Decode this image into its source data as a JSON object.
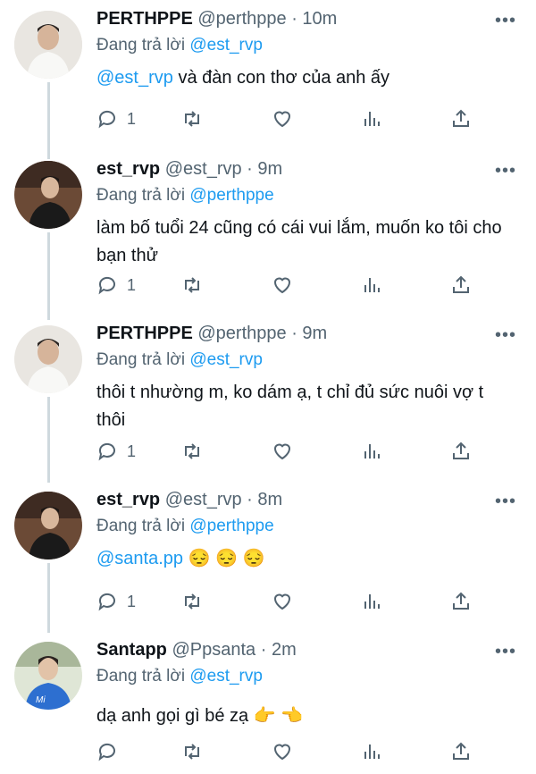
{
  "tweets": [
    {
      "name": "PERTHPPE",
      "handle": "@perthppe",
      "sep": " · ",
      "time": "10m",
      "reply_prefix": "Đang trả lời ",
      "reply_to": "@est_rvp",
      "body_mention": "@est_rvp",
      "body_text": " và đàn con thơ của anh ấy",
      "more": "•••",
      "reply_count": "1"
    },
    {
      "name": "est_rvp",
      "handle": "@est_rvp",
      "sep": " · ",
      "time": "9m",
      "reply_prefix": "Đang trả lời ",
      "reply_to": "@perthppe",
      "body_mention": "",
      "body_text": "làm bố tuổi 24 cũng có cái vui lắm, muốn ko tôi cho bạn thử",
      "more": "•••",
      "reply_count": "1"
    },
    {
      "name": "PERTHPPE",
      "handle": "@perthppe",
      "sep": " · ",
      "time": "9m",
      "reply_prefix": "Đang trả lời ",
      "reply_to": "@est_rvp",
      "body_mention": "",
      "body_text": "thôi t nhường m, ko dám ạ, t chỉ đủ sức nuôi vợ t thôi",
      "more": "•••",
      "reply_count": "1"
    },
    {
      "name": "est_rvp",
      "handle": "@est_rvp",
      "sep": " · ",
      "time": "8m",
      "reply_prefix": "Đang trả lời ",
      "reply_to": "@perthppe",
      "body_mention": "@santa.pp",
      "body_text": " 😔 😔 😔",
      "more": "•••",
      "reply_count": "1"
    },
    {
      "name": "Santapp",
      "handle": "@Ppsanta",
      "sep": " · ",
      "time": "2m",
      "reply_prefix": "Đang trả lời ",
      "reply_to": "@est_rvp",
      "body_mention": "",
      "body_text": "dạ anh gọi gì bé zạ 👉 👈",
      "more": "•••",
      "reply_count": ""
    }
  ],
  "colors": {
    "accent": "#1d9bf0",
    "muted": "#536471",
    "text": "#0f1419",
    "thread_line": "#cfd9de"
  },
  "icons": [
    "reply-icon",
    "retweet-icon",
    "like-icon",
    "views-icon",
    "share-icon",
    "more-icon"
  ]
}
